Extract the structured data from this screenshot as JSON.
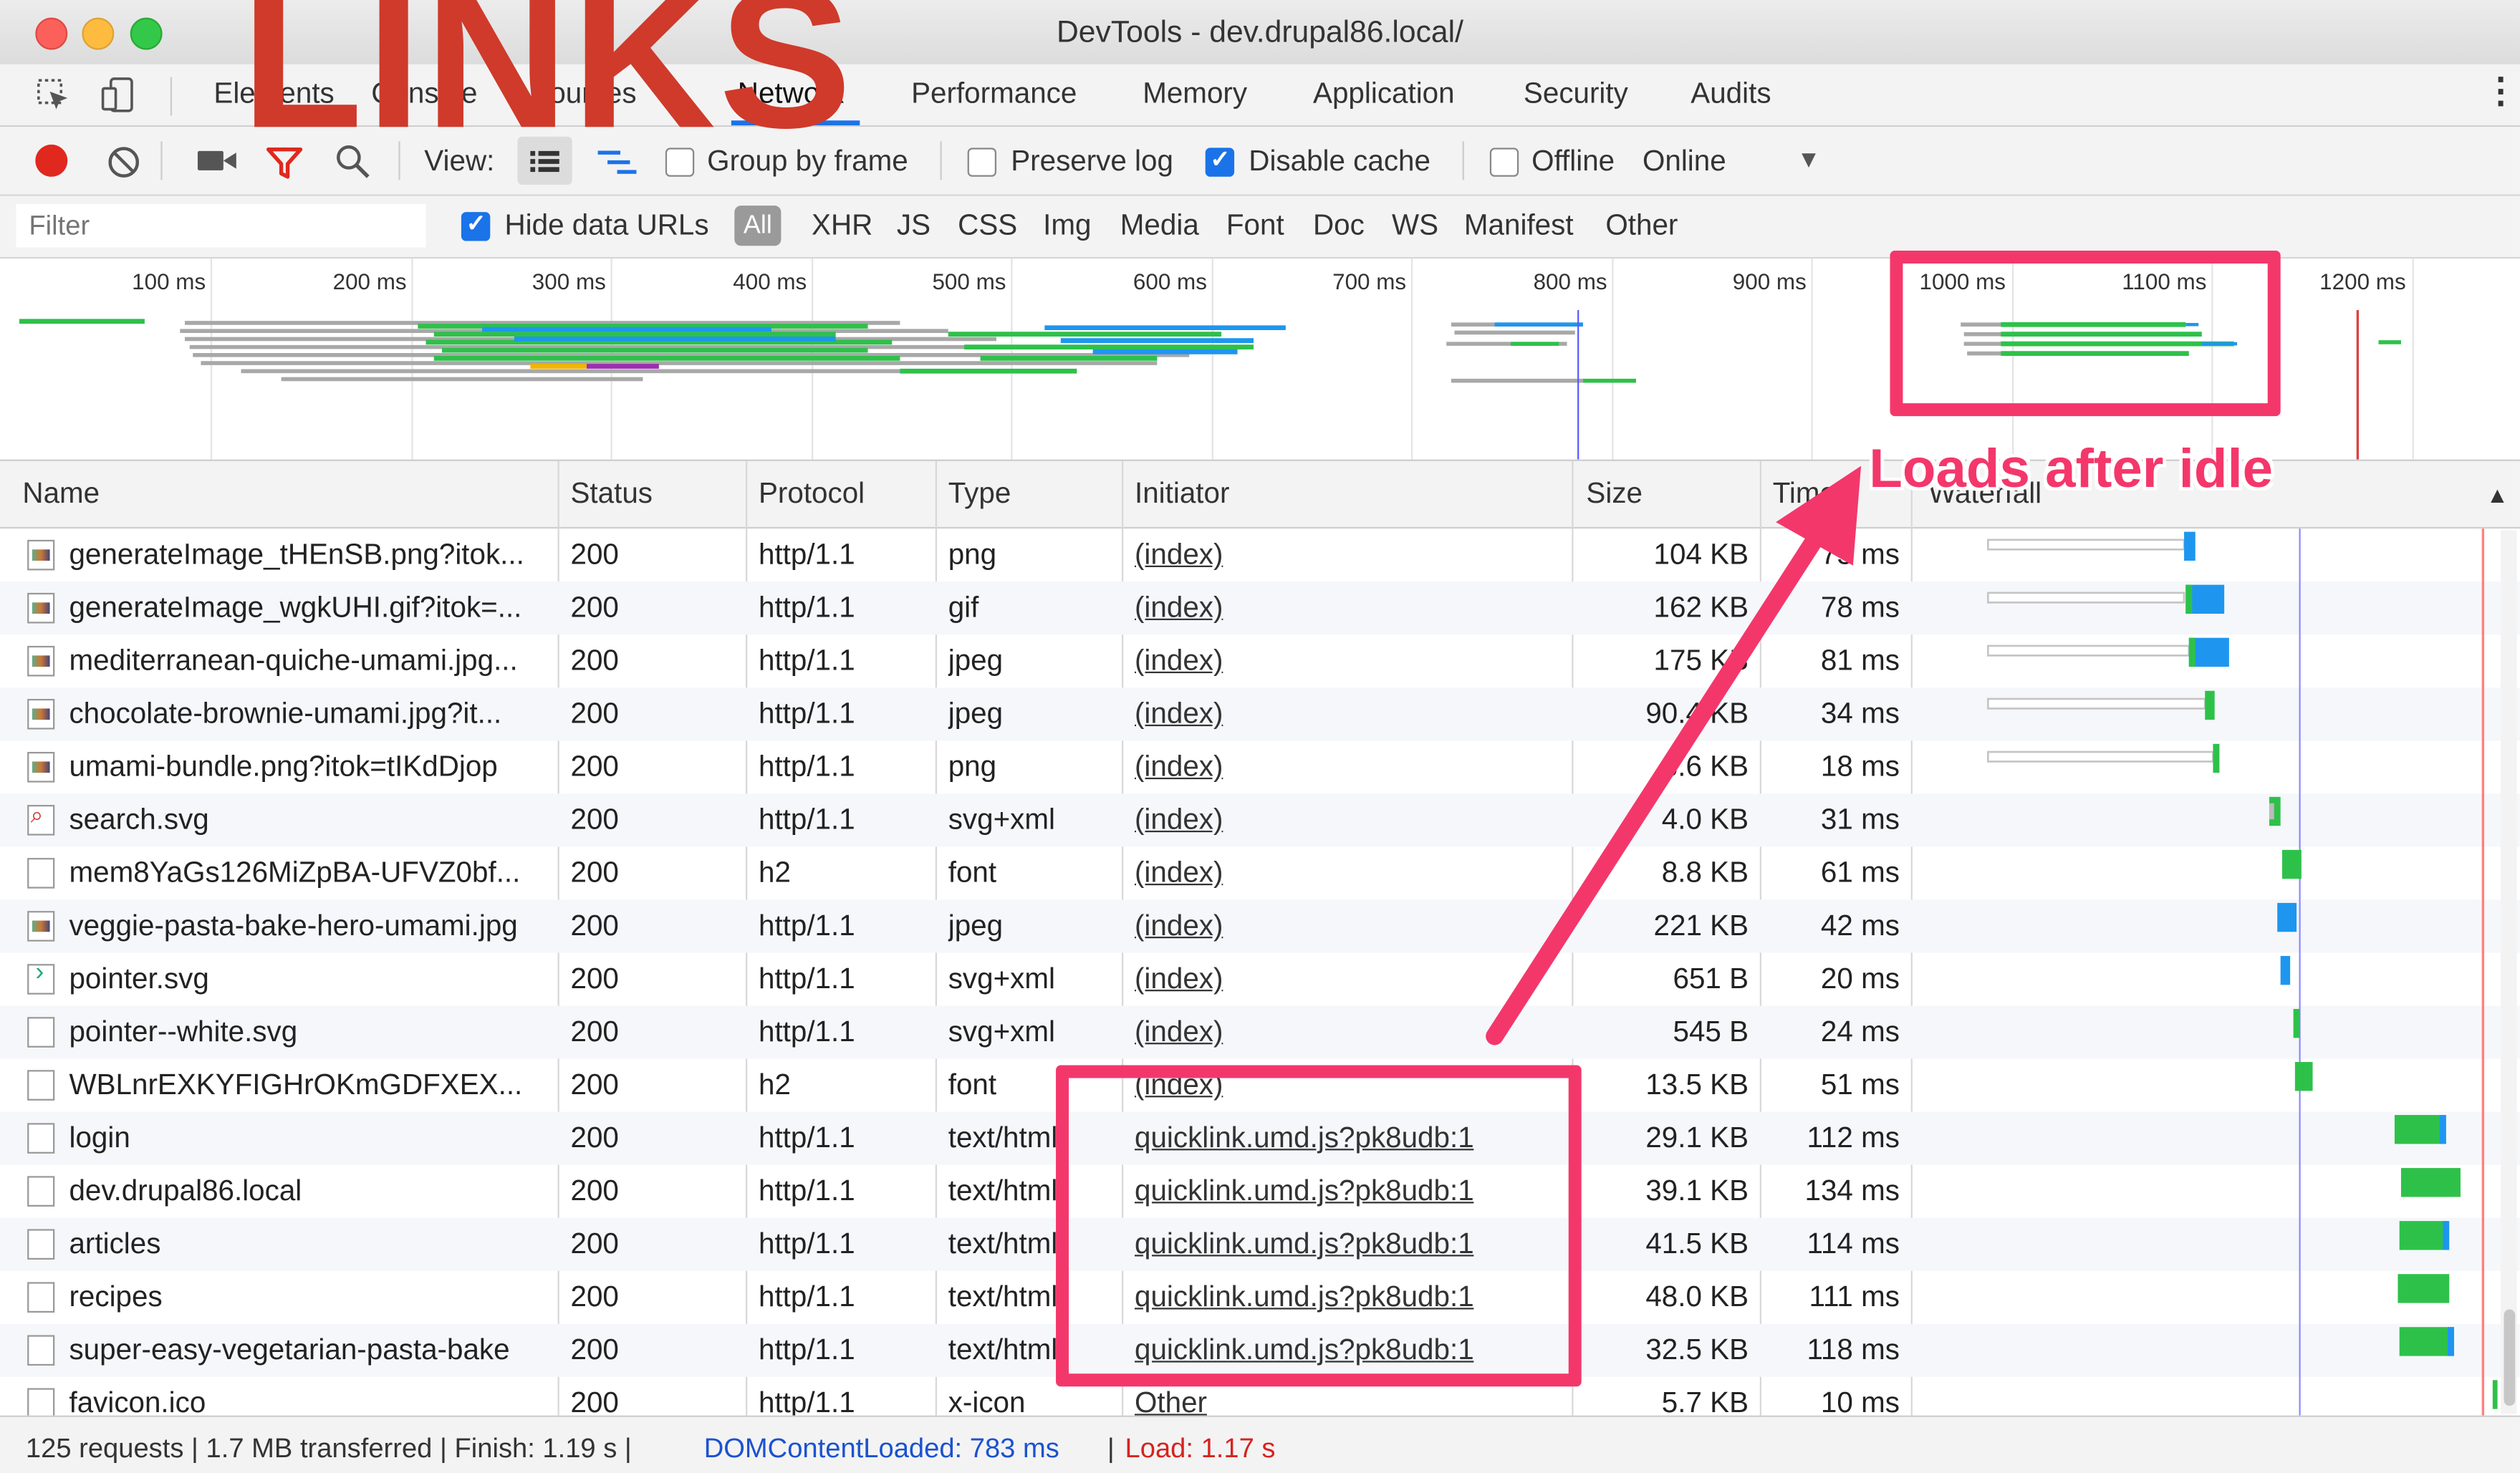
{
  "overlay": {
    "title": "LINKS",
    "annotation": "Loads after idle"
  },
  "window": {
    "title": "DevTools - dev.drupal86.local/"
  },
  "tabs": [
    {
      "label": "Elements"
    },
    {
      "label": "Console"
    },
    {
      "label": "Sources"
    },
    {
      "label": "Network"
    },
    {
      "label": "Performance"
    },
    {
      "label": "Memory"
    },
    {
      "label": "Application"
    },
    {
      "label": "Security"
    },
    {
      "label": "Audits"
    }
  ],
  "toolbar": {
    "view_label": "View:",
    "group_by_frame": "Group by frame",
    "preserve_log": "Preserve log",
    "disable_cache": "Disable cache",
    "offline": "Offline",
    "online": "Online"
  },
  "filterbar": {
    "placeholder": "Filter",
    "hide_data_urls": "Hide data URLs",
    "all": "All",
    "types": [
      "XHR",
      "JS",
      "CSS",
      "Img",
      "Media",
      "Font",
      "Doc",
      "WS",
      "Manifest",
      "Other"
    ]
  },
  "overview_ticks": [
    "100 ms",
    "200 ms",
    "300 ms",
    "400 ms",
    "500 ms",
    "600 ms",
    "700 ms",
    "800 ms",
    "900 ms",
    "1000 ms",
    "1100 ms",
    "1200 ms"
  ],
  "columns": {
    "name": "Name",
    "status": "Status",
    "protocol": "Protocol",
    "type": "Type",
    "initiator": "Initiator",
    "size": "Size",
    "time": "Time",
    "waterfall": "Waterfall"
  },
  "rows": [
    {
      "name": "generateImage_tHEnSB.png?itok...",
      "status": "200",
      "protocol": "http/1.1",
      "type": "png",
      "initiator": "(index)",
      "size": "104 KB",
      "time": "75 ms"
    },
    {
      "name": "generateImage_wgkUHI.gif?itok=...",
      "status": "200",
      "protocol": "http/1.1",
      "type": "gif",
      "initiator": "(index)",
      "size": "162 KB",
      "time": "78 ms"
    },
    {
      "name": "mediterranean-quiche-umami.jpg...",
      "status": "200",
      "protocol": "http/1.1",
      "type": "jpeg",
      "initiator": "(index)",
      "size": "175 KB",
      "time": "81 ms"
    },
    {
      "name": "chocolate-brownie-umami.jpg?it...",
      "status": "200",
      "protocol": "http/1.1",
      "type": "jpeg",
      "initiator": "(index)",
      "size": "90.4 KB",
      "time": "34 ms"
    },
    {
      "name": "umami-bundle.png?itok=tIKdDjop",
      "status": "200",
      "protocol": "http/1.1",
      "type": "png",
      "initiator": "(index)",
      "size": "8.6 KB",
      "time": "18 ms"
    },
    {
      "name": "search.svg",
      "status": "200",
      "protocol": "http/1.1",
      "type": "svg+xml",
      "initiator": "(index)",
      "size": "4.0 KB",
      "time": "31 ms"
    },
    {
      "name": "mem8YaGs126MiZpBA-UFVZ0bf...",
      "status": "200",
      "protocol": "h2",
      "type": "font",
      "initiator": "(index)",
      "size": "8.8 KB",
      "time": "61 ms"
    },
    {
      "name": "veggie-pasta-bake-hero-umami.jpg",
      "status": "200",
      "protocol": "http/1.1",
      "type": "jpeg",
      "initiator": "(index)",
      "size": "221 KB",
      "time": "42 ms"
    },
    {
      "name": "pointer.svg",
      "status": "200",
      "protocol": "http/1.1",
      "type": "svg+xml",
      "initiator": "(index)",
      "size": "651 B",
      "time": "20 ms"
    },
    {
      "name": "pointer--white.svg",
      "status": "200",
      "protocol": "http/1.1",
      "type": "svg+xml",
      "initiator": "(index)",
      "size": "545 B",
      "time": "24 ms"
    },
    {
      "name": "WBLnrEXKYFIGHrOKmGDFXEX...",
      "status": "200",
      "protocol": "h2",
      "type": "font",
      "initiator": "(index)",
      "size": "13.5 KB",
      "time": "51 ms"
    },
    {
      "name": "login",
      "status": "200",
      "protocol": "http/1.1",
      "type": "text/html",
      "initiator": "quicklink.umd.js?pk8udb:1",
      "size": "29.1 KB",
      "time": "112 ms"
    },
    {
      "name": "dev.drupal86.local",
      "status": "200",
      "protocol": "http/1.1",
      "type": "text/html",
      "initiator": "quicklink.umd.js?pk8udb:1",
      "size": "39.1 KB",
      "time": "134 ms"
    },
    {
      "name": "articles",
      "status": "200",
      "protocol": "http/1.1",
      "type": "text/html",
      "initiator": "quicklink.umd.js?pk8udb:1",
      "size": "41.5 KB",
      "time": "114 ms"
    },
    {
      "name": "recipes",
      "status": "200",
      "protocol": "http/1.1",
      "type": "text/html",
      "initiator": "quicklink.umd.js?pk8udb:1",
      "size": "48.0 KB",
      "time": "111 ms"
    },
    {
      "name": "super-easy-vegetarian-pasta-bake",
      "status": "200",
      "protocol": "http/1.1",
      "type": "text/html",
      "initiator": "quicklink.umd.js?pk8udb:1",
      "size": "32.5 KB",
      "time": "118 ms"
    },
    {
      "name": "favicon.ico",
      "status": "200",
      "protocol": "http/1.1",
      "type": "x-icon",
      "initiator": "Other",
      "size": "5.7 KB",
      "time": "10 ms"
    }
  ],
  "statusbar": {
    "summary": "125 requests | 1.7 MB transferred | Finish: 1.19 s |",
    "dcl": "DOMContentLoaded: 783 ms",
    "sep": "|",
    "load": "Load: 1.17 s"
  },
  "colors": {
    "accent": "#1a73e8",
    "annotation": "#f4376b",
    "title": "#cf3a2b",
    "bar_green": "#2ec14a",
    "bar_blue": "#1e96ef"
  }
}
